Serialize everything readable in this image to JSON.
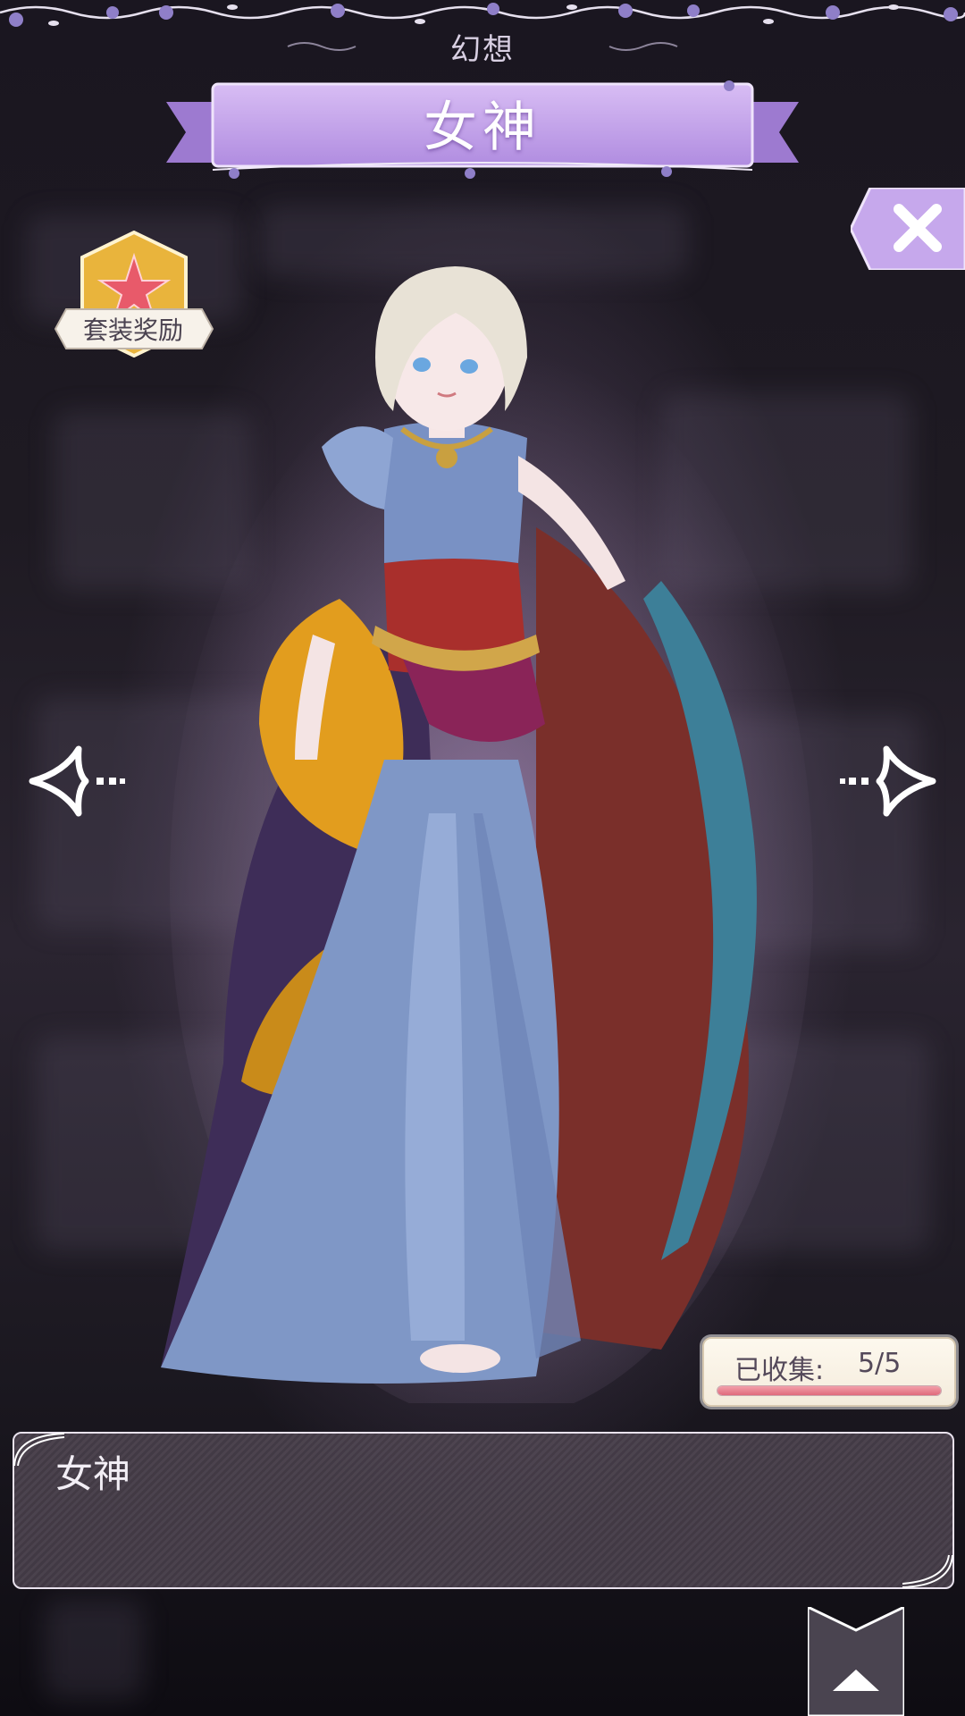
{
  "header": {
    "category": "幻想",
    "title": "女神"
  },
  "reward_badge": {
    "label": "套装奖励",
    "icon": "star-icon"
  },
  "close_button": {
    "icon": "close-icon"
  },
  "navigation": {
    "prev_icon": "arrow-left-icon",
    "next_icon": "arrow-right-icon"
  },
  "collection": {
    "label": "已收集:",
    "value": "5/5",
    "progress": 1.0
  },
  "description": {
    "text": "女神"
  },
  "bottom_tab": {
    "icon": "chevron-up-icon"
  },
  "colors": {
    "ribbon": "#c9a6ec",
    "ribbon_dark": "#9d7ad0",
    "accent_pink": "#e06a7c",
    "gold": "#e9b43c"
  }
}
